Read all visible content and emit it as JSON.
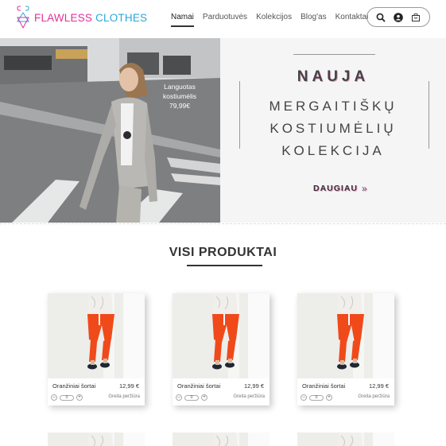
{
  "brand": {
    "part1": "FLAWLESS",
    "part2": "CLOTHES",
    "colors": {
      "pink": "#e0309a",
      "blue": "#2aa8d8"
    }
  },
  "nav": {
    "items": [
      {
        "label": "Namai",
        "active": true
      },
      {
        "label": "Parduotuvės",
        "active": false
      },
      {
        "label": "Kolekcijos",
        "active": false
      },
      {
        "label": "Blog'as",
        "active": false
      },
      {
        "label": "Kontaktai",
        "active": false
      }
    ]
  },
  "header_icons": [
    "search-icon",
    "user-icon",
    "cart-icon"
  ],
  "hero": {
    "photo_label_line1": "Languotas",
    "photo_label_line2": "kostiumėlis",
    "photo_label_price": "79,99€",
    "badge": "NAUJA",
    "line1": "MERGAITIŠKŲ",
    "line2": "KOSTIUMĖLIŲ",
    "line3": "KOLEKCIJA",
    "more_label": "DAUGIAU",
    "more_chevron": "»"
  },
  "section": {
    "title": "VISI PRODUKTAI"
  },
  "products": [
    {
      "name": "Oranžiniai šortai",
      "price": "12,99 €",
      "qty": "0",
      "minus": "–",
      "plus": "+",
      "quick_view": "Greita peržiūra"
    },
    {
      "name": "Oranžiniai šortai",
      "price": "12,99 €",
      "qty": "0",
      "minus": "–",
      "plus": "+",
      "quick_view": "Greita peržiūra"
    },
    {
      "name": "Oranžiniai šortai",
      "price": "12,99 €",
      "qty": "0",
      "minus": "–",
      "plus": "+",
      "quick_view": "Greita peržiūra"
    }
  ]
}
